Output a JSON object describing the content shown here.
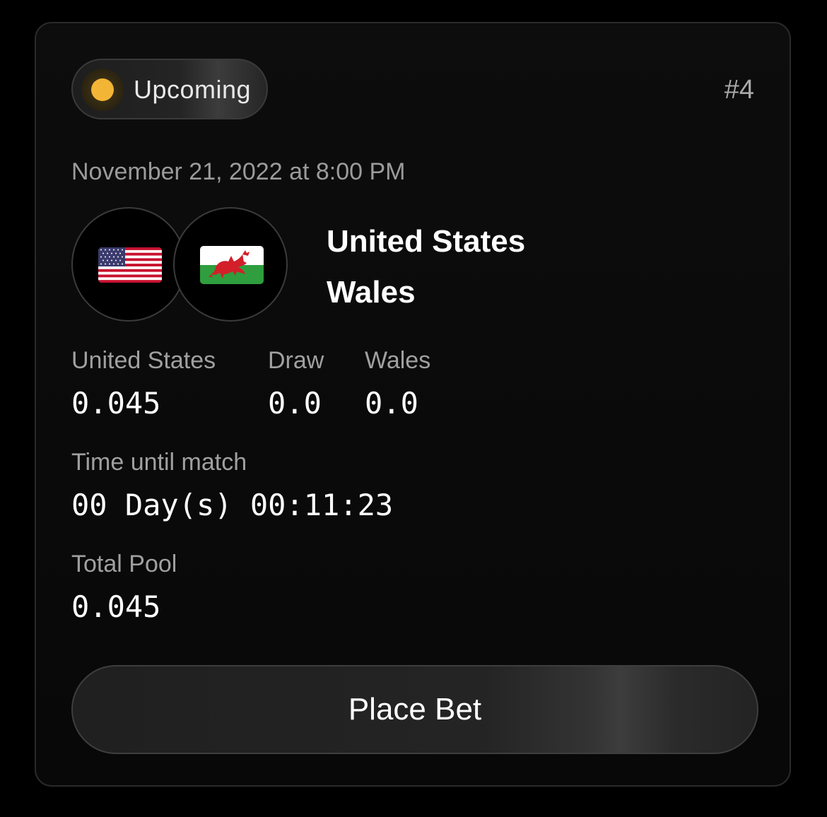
{
  "match": {
    "status": "Upcoming",
    "status_color": "#f2b535",
    "number": "#4",
    "date": "November 21, 2022 at 8:00 PM",
    "home_team": "United States",
    "away_team": "Wales",
    "home_flag_icon": "us-flag-icon",
    "away_flag_icon": "wales-flag-icon"
  },
  "odds": {
    "home_label": "United States",
    "home_value": "0.045",
    "draw_label": "Draw",
    "draw_value": "0.0",
    "away_label": "Wales",
    "away_value": "0.0"
  },
  "countdown": {
    "label": "Time until match",
    "value": "00 Day(s) 00:11:23"
  },
  "pool": {
    "label": "Total Pool",
    "value": "0.045"
  },
  "actions": {
    "place_bet_label": "Place Bet"
  }
}
